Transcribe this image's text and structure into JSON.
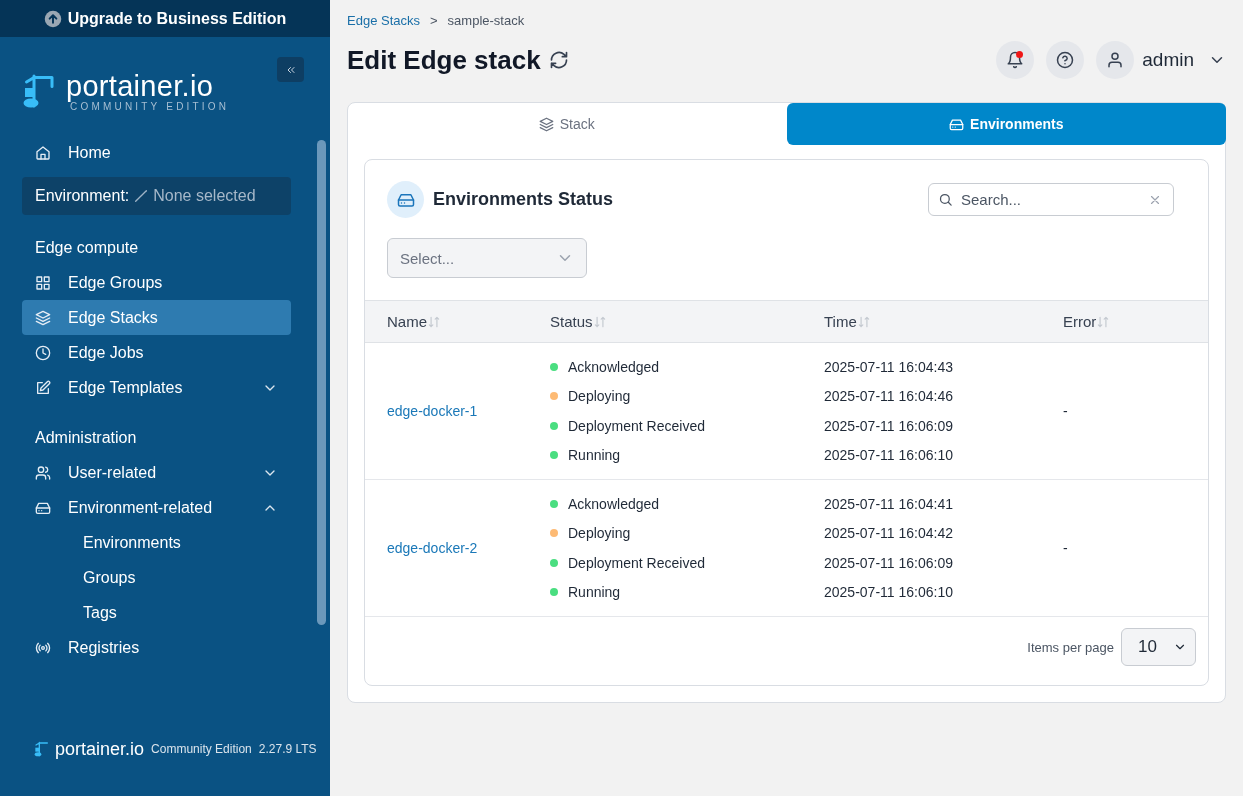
{
  "upgrade_banner": {
    "label": "Upgrade to Business Edition"
  },
  "sidebar": {
    "logo": {
      "name": "portainer.io",
      "edition": "COMMUNITY EDITION"
    },
    "home": {
      "label": "Home",
      "selected": false
    },
    "environment": {
      "label": "Environment:",
      "value": "None selected"
    },
    "sections": [
      {
        "title": "Edge compute",
        "items": [
          {
            "label": "Edge Groups",
            "selected": false
          },
          {
            "label": "Edge Stacks",
            "selected": true
          },
          {
            "label": "Edge Jobs",
            "selected": false
          },
          {
            "label": "Edge Templates",
            "selected": false,
            "expanded": false
          }
        ]
      },
      {
        "title": "Administration",
        "items": [
          {
            "label": "User-related",
            "selected": false,
            "expanded": false
          },
          {
            "label": "Environment-related",
            "selected": false,
            "expanded": true,
            "children": [
              {
                "label": "Environments",
                "selected": false
              },
              {
                "label": "Groups",
                "selected": false
              },
              {
                "label": "Tags",
                "selected": false
              }
            ]
          },
          {
            "label": "Registries",
            "selected": false
          }
        ]
      }
    ],
    "footer": {
      "brand": "portainer.io",
      "edition": "Community Edition",
      "version": "2.27.9 LTS"
    }
  },
  "breadcrumbs": [
    {
      "label": "Edge Stacks",
      "kind": "link"
    },
    {
      "label": "sample-stack",
      "kind": "current"
    }
  ],
  "breadcrumb_separator": ">",
  "page_title": "Edit Edge stack",
  "header": {
    "notifications_unread": true,
    "user": "admin"
  },
  "tabs": [
    {
      "label": "Stack",
      "selected": false
    },
    {
      "label": "Environments",
      "selected": true
    }
  ],
  "panel": {
    "title": "Environments Status",
    "search": {
      "placeholder": "Search..."
    },
    "filter": {
      "placeholder": "Select..."
    },
    "table": {
      "columns": [
        "Name",
        "Status",
        "Time",
        "Error"
      ],
      "rows": [
        {
          "name": "edge-docker-1",
          "error": "-",
          "events": [
            {
              "status": "Acknowledged",
              "time": "2025-07-11 16:04:43",
              "color": "#4ade80"
            },
            {
              "status": "Deploying",
              "time": "2025-07-11 16:04:46",
              "color": "#fdba74"
            },
            {
              "status": "Deployment Received",
              "time": "2025-07-11 16:06:09",
              "color": "#4ade80"
            },
            {
              "status": "Running",
              "time": "2025-07-11 16:06:10",
              "color": "#4ade80"
            }
          ]
        },
        {
          "name": "edge-docker-2",
          "error": "-",
          "events": [
            {
              "status": "Acknowledged",
              "time": "2025-07-11 16:04:41",
              "color": "#4ade80"
            },
            {
              "status": "Deploying",
              "time": "2025-07-11 16:04:42",
              "color": "#fdba74"
            },
            {
              "status": "Deployment Received",
              "time": "2025-07-11 16:06:09",
              "color": "#4ade80"
            },
            {
              "status": "Running",
              "time": "2025-07-11 16:06:10",
              "color": "#4ade80"
            }
          ]
        }
      ]
    },
    "pagination": {
      "label": "Items per page",
      "value": "10"
    }
  }
}
